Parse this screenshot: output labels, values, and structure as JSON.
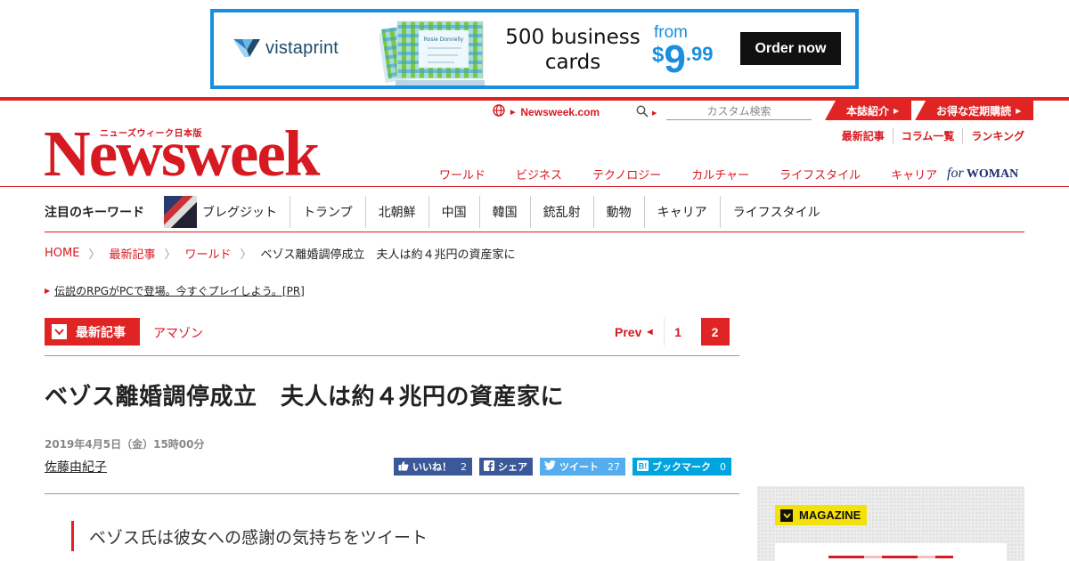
{
  "ad": {
    "brand": "vistaprint",
    "brand_mark": ".",
    "headline_line1": "500 business",
    "headline_line2": "cards",
    "from": "from",
    "price_currency": "$",
    "price_whole": "9",
    "price_cents": ".99",
    "cta": "Order now",
    "card_sample_name": "Rosie Donnelly",
    "colors": {
      "border": "#1a8fe0",
      "price": "#1a8fe0",
      "cta_bg": "#111111"
    }
  },
  "header": {
    "logo": "Newsweek",
    "logo_sub": "ニューズウィーク日本版",
    "global_link": "Newsweek.com",
    "search_placeholder": "カスタム検索",
    "top_tabs": [
      "本誌紹介",
      "お得な定期購読"
    ],
    "sublinks": [
      "最新記事",
      "コラム一覧",
      "ランキング"
    ],
    "nav": [
      "ワールド",
      "ビジネス",
      "テクノロジー",
      "カルチャー",
      "ライフスタイル",
      "キャリア"
    ],
    "for_woman_for": "for",
    "for_woman": "WOMAN",
    "colors": {
      "brand_red": "#d71921",
      "bar_red": "#e02424"
    }
  },
  "keywords": {
    "title": "注目のキーワード",
    "items": [
      "ブレグジット",
      "トランプ",
      "北朝鮮",
      "中国",
      "韓国",
      "銃乱射",
      "動物",
      "キャリア",
      "ライフスタイル"
    ]
  },
  "breadcrumb": {
    "items": [
      "HOME",
      "最新記事",
      "ワールド"
    ],
    "current": "ベゾス離婚調停成立　夫人は約４兆円の資産家に"
  },
  "promo": {
    "text": "伝説のRPGがPCで登場。今すぐプレイしよう。[PR]"
  },
  "section": {
    "tag": "最新記事",
    "sub": "アマゾン",
    "pager": {
      "prev": "Prev",
      "pages": [
        "1",
        "2"
      ],
      "current": "2"
    }
  },
  "article": {
    "title": "ベゾス離婚調停成立　夫人は約４兆円の資産家に",
    "date": "2019年4月5日（金）15時00分",
    "author": "佐藤由紀子",
    "lead": "ベゾス氏は彼女への感謝の気持ちをツイート",
    "social": {
      "like": "いいね！",
      "like_count": "2",
      "share": "シェア",
      "tweet": "ツイート",
      "tweet_count": "27",
      "bookmark": "ブックマーク",
      "bookmark_count": "0"
    }
  },
  "sidebar": {
    "magazine_label": "MAGAZINE"
  }
}
